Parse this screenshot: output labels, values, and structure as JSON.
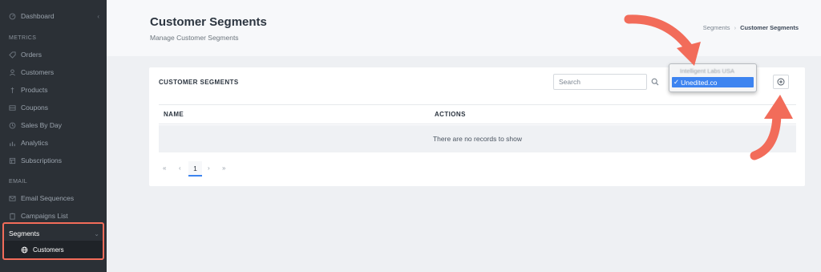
{
  "sidebar": {
    "items": [
      {
        "label": "Dashboard",
        "icon": "dashboard-icon"
      },
      {
        "label": "Orders",
        "icon": "tag-icon"
      },
      {
        "label": "Customers",
        "icon": "customers-icon"
      },
      {
        "label": "Products",
        "icon": "products-icon"
      },
      {
        "label": "Coupons",
        "icon": "coupon-icon"
      },
      {
        "label": "Sales By Day",
        "icon": "clock-icon"
      },
      {
        "label": "Analytics",
        "icon": "analytics-icon"
      },
      {
        "label": "Subscriptions",
        "icon": "subscriptions-icon"
      },
      {
        "label": "Email Sequences",
        "icon": "email-icon"
      },
      {
        "label": "Campaigns List",
        "icon": "clipboard-icon"
      }
    ],
    "sections": {
      "metrics": "METRICS",
      "email": "EMAIL"
    },
    "segments": {
      "label": "Segments",
      "chevron": "chevron-down-icon"
    },
    "segments_sub": {
      "label": "Customers",
      "icon": "globe-icon"
    },
    "collapse_icon": "chevron-left-icon",
    "highlight_color": "#f26c5a"
  },
  "header": {
    "title": "Customer Segments",
    "subtitle": "Manage Customer Segments",
    "breadcrumb": [
      "Segments",
      "Customer Segments"
    ]
  },
  "card": {
    "title": "CUSTOMER SEGMENTS",
    "search": {
      "placeholder": "Search",
      "value": ""
    },
    "store_select": {
      "options": [
        "Intelligent Labs USA",
        "Unedited.co"
      ],
      "selected": "Unedited.co"
    },
    "add_icon": "plus-circle-icon",
    "table": {
      "columns": [
        "NAME",
        "ACTIONS"
      ],
      "empty_message": "There are no records to show"
    },
    "pagination": {
      "first": "«",
      "prev": "‹",
      "current": "1",
      "next": "›",
      "last": "»"
    }
  },
  "colors": {
    "accent": "#3d84f0",
    "annotation_arrow": "#f26c5a",
    "sidebar_bg": "#2b3036"
  }
}
